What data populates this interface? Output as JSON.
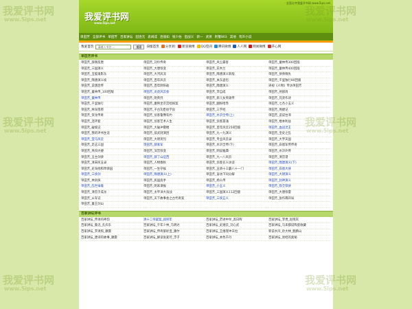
{
  "watermark": {
    "text": "我爱评书网",
    "url": "www.5ips.net"
  },
  "header": {
    "topline": "· 全面分齐我爱评书网 www.5ips.net",
    "logo": "我爱评书网",
    "logo_sub": "www.5ips.net"
  },
  "nav": [
    "单田芳",
    "全部评书",
    "单田芳",
    "百家讲坛",
    "田连元",
    "袁阔成",
    "连丽如",
    "张少佐",
    "田战义",
    "新一",
    "武侠",
    "刑警803",
    "其他",
    "有声小说"
  ],
  "toolbar": {
    "home": "我爱首页",
    "search_placeholder": "请输入书名...",
    "search_btn": "搜索",
    "old_home": "旧版首页",
    "share": "分享到:",
    "sina": "新浪微博",
    "qq": "QQ空间",
    "tencent": "腾讯微博",
    "renren": "人人网",
    "netease": "网易微博",
    "kaixin": "开心网"
  },
  "colors": {
    "nav": "#5e8f0e",
    "accent": "#ff8a00",
    "header": "#8fc51c"
  },
  "sections": [
    {
      "title": "单田芳评书",
      "items": [
        {
          "t": "单田芳_薛刚反唐",
          "b": false
        },
        {
          "t": "单田芳_刘伶传奇",
          "b": false
        },
        {
          "t": "单田芳_风尘豪客",
          "b": false
        },
        {
          "t": "单田芳_童林传300回版",
          "b": false
        },
        {
          "t": "单田芳_三国演义",
          "b": false
        },
        {
          "t": "单田芳_大唐惊变",
          "b": false
        },
        {
          "t": "单田芳_花木兰",
          "b": false
        },
        {
          "t": "单田芳_童林传400回版",
          "b": false
        },
        {
          "t": "单田芳_玉狐鬼影东",
          "b": false
        },
        {
          "t": "单田芳_大河风流",
          "b": false
        },
        {
          "t": "单田芳_隋唐演义新版",
          "b": false
        },
        {
          "t": "单田芳_侠骨情仇",
          "b": false
        },
        {
          "t": "单田芳_隋唐演义续",
          "b": false
        },
        {
          "t": "单田芳_百年风云",
          "b": false
        },
        {
          "t": "单田芳_关东盗侣",
          "b": false
        },
        {
          "t": "单田芳_千里独行80回版",
          "b": false
        },
        {
          "t": "单田芳_说唐后传",
          "b": false
        },
        {
          "t": "单田芳_百年阴阳劫",
          "b": false
        },
        {
          "t": "单田芳_隋唐演义",
          "b": false
        },
        {
          "t": "央视《人物》专访单田芳",
          "b": false
        },
        {
          "t": "单田芳_童林传_100回版",
          "b": false
        },
        {
          "t": "单田芳_龙虎风云会",
          "b": true
        },
        {
          "t": "单田芳_李自成",
          "b": false
        },
        {
          "t": "单田芳_刑部尚",
          "b": false
        },
        {
          "t": "单田芳_童林传",
          "b": true
        },
        {
          "t": "单田芳_明英烈",
          "b": false
        },
        {
          "t": "单田芳_新儿女英雄传",
          "b": false
        },
        {
          "t": "单田芳_兄弟作诗",
          "b": false
        },
        {
          "t": "单田芳_千里独行",
          "b": false
        },
        {
          "t": "单田芳_康熙坐京宫暗探案",
          "b": false
        },
        {
          "t": "单田芳_胭粉哈赤",
          "b": false
        },
        {
          "t": "单田芳_七杰小五义",
          "b": false
        },
        {
          "t": "单田芳_林海雪原",
          "b": false
        },
        {
          "t": "单田芳_千古功臣徐学良",
          "b": false
        },
        {
          "t": "单田芳_三字经",
          "b": false
        },
        {
          "t": "单田芳_燕捷记",
          "b": false
        },
        {
          "t": "单田芳_贺龙传奇",
          "b": false
        },
        {
          "t": "单田芳_侦客鲁豫有约",
          "b": false
        },
        {
          "t": "单田芳_水浒全传(上)",
          "b": true
        },
        {
          "t": "单田芳_说说台湾",
          "b": false
        },
        {
          "t": "单田芳_连环套",
          "b": false
        },
        {
          "t": "单田芳_侦客艺术人生",
          "b": false
        },
        {
          "t": "单田芳_侦客聂涌",
          "b": false
        },
        {
          "t": "单田芳_棍本利益",
          "b": false
        },
        {
          "t": "单田芳_破城记",
          "b": false
        },
        {
          "t": "单田芳_大破冲霄楼",
          "b": false
        },
        {
          "t": "单田芳_百年风云250回版",
          "b": false
        },
        {
          "t": "单田芳_血战灵王",
          "b": true
        },
        {
          "t": "单田芳_我的评书生涯",
          "b": false
        },
        {
          "t": "单田芳_孩武则演团",
          "b": false
        },
        {
          "t": "单田芳_九一九演义",
          "b": false
        },
        {
          "t": "单田芳_宝史之乱",
          "b": false
        },
        {
          "t": "单田芳_亚马风云",
          "b": true
        },
        {
          "t": "单田芳_大明英烈",
          "b": false
        },
        {
          "t": "单田芳_专业风云录",
          "b": false
        },
        {
          "t": "单田芳_大宇天国",
          "b": false
        },
        {
          "t": "单田芳_走这三国",
          "b": false
        },
        {
          "t": "单田芳_薛家军",
          "b": true
        },
        {
          "t": "单田芳_水浒全传(下)",
          "b": false
        },
        {
          "t": "单田芳_白眉军传传奇",
          "b": false
        },
        {
          "t": "单田芳_燕归大捷",
          "b": false
        },
        {
          "t": "单田芳_深宫惊变",
          "b": false
        },
        {
          "t": "单田芳_明说雅典",
          "b": false
        },
        {
          "t": "单田芳_水浒外传",
          "b": false
        },
        {
          "t": "单田芳_五主剑侠",
          "b": false
        },
        {
          "t": "单田芳_薛丁山征西",
          "b": true
        },
        {
          "t": "单田芳_九一八风云",
          "b": false
        },
        {
          "t": "单田芳_清宫谱",
          "b": false
        },
        {
          "t": "单田芳_清末民五录",
          "b": false
        },
        {
          "t": "单田芳_人物春秋",
          "b": false
        },
        {
          "t": "单田芳_侦客名人访谈",
          "b": false
        },
        {
          "t": "单田芳_隋唐演义(下)",
          "b": true
        },
        {
          "t": "单田芳_史海他和草驿园",
          "b": false
        },
        {
          "t": "单田芳_一生守候",
          "b": false
        },
        {
          "t": "单田芳_五骄十三霸八十一门",
          "b": false
        },
        {
          "t": "单田芳_白眉大侠",
          "b": true
        },
        {
          "t": "单田芳_三侠剑",
          "b": true
        },
        {
          "t": "单田芳_隋唐演义(上)",
          "b": true
        },
        {
          "t": "单田芳_盲坊下同分解",
          "b": false
        },
        {
          "t": "单田芳_大明演义",
          "b": true
        },
        {
          "t": "单田芳_林剑侠",
          "b": false
        },
        {
          "t": "单田芳_民国高手",
          "b": false
        },
        {
          "t": "单田芳_杨么传",
          "b": false
        },
        {
          "t": "单田芳_封神演义",
          "b": true
        },
        {
          "t": "单田芳_乱世枭雄",
          "b": true
        },
        {
          "t": "单田芳_明末谍报",
          "b": false
        },
        {
          "t": "单田芳_小五义",
          "b": true
        },
        {
          "t": "单田芳_铁全铁侠",
          "b": true
        },
        {
          "t": "单田芳_清官于成龙",
          "b": false
        },
        {
          "t": "单田芳_太平洋大海战",
          "b": false
        },
        {
          "t": "单田芳_三国演义112回版",
          "b": false
        },
        {
          "t": "单田芳_大唐惊雷",
          "b": false
        },
        {
          "t": "单田芳_从军记",
          "b": false
        },
        {
          "t": "单田芳_天下故事会之古代奇案",
          "b": false
        },
        {
          "t": "单田芳_三侠五义",
          "b": true
        },
        {
          "t": "单田芳_张作霖开局",
          "b": false
        },
        {
          "t": "单田芳_童王剑山",
          "b": false
        },
        {
          "t": "",
          "b": false
        },
        {
          "t": "",
          "b": false
        },
        {
          "t": "",
          "b": false
        }
      ]
    },
    {
      "title": "百家讲坛评书",
      "items": [
        {
          "t": "百家讲坛_传承的神韵",
          "b": false
        },
        {
          "t": "清十二帝疑案_阎崇年",
          "b": true
        },
        {
          "t": "百家讲坛_范进中举_高日晖",
          "b": false
        },
        {
          "t": "百家讲坛_李煜_赵晓岚",
          "b": false
        },
        {
          "t": "百家讲坛_鲁迅_孔庆东",
          "b": false
        },
        {
          "t": "百家讲坛_千年少林_马明达",
          "b": false
        },
        {
          "t": "百家讲坛_史湘云_刘心武",
          "b": false
        },
        {
          "t": "百家讲坛_马未都说陶瓷收藏",
          "b": false
        },
        {
          "t": "百家讲坛_李清照_康震",
          "b": false
        },
        {
          "t": "百家讲坛_传奇紫砂壶_康尔",
          "b": false
        },
        {
          "t": "百家讲坛_王维理冲天拉",
          "b": false
        },
        {
          "t": "新说水浒_孙大林_鲍鹏山",
          "b": false
        },
        {
          "t": "百家讲坛_唐诗的故事_康震",
          "b": false
        },
        {
          "t": "百家讲坛_解读张爱玲_浮子",
          "b": false
        },
        {
          "t": "百家讲坛_本色千丹",
          "b": false
        },
        {
          "t": "百家讲坛_易经的奥秘",
          "b": false
        }
      ]
    }
  ]
}
